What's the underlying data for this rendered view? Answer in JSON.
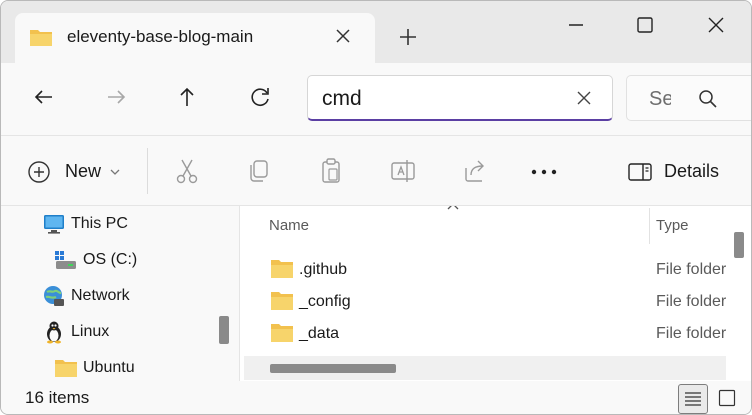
{
  "window": {
    "tab_title": "eleventy-base-blog-main",
    "icons": {
      "tab_icon": "folder-icon",
      "tab_close": "close-icon",
      "new_tab": "plus-icon",
      "minimize": "minimize-icon",
      "maximize": "maximize-icon",
      "close": "close-icon"
    }
  },
  "navigation": {
    "icons": [
      "back-arrow-icon",
      "forward-arrow-icon",
      "up-arrow-icon",
      "refresh-icon"
    ],
    "address_value": "cmd",
    "search_placeholder": "Se"
  },
  "toolbar": {
    "new_label": "New",
    "details_label": "Details",
    "icons": [
      "cut-icon",
      "copy-icon",
      "paste-icon",
      "rename-icon",
      "share-icon",
      "more-icon"
    ]
  },
  "sidebar": {
    "items": [
      {
        "label": "This PC",
        "icon": "this-pc-icon"
      },
      {
        "label": "OS (C:)",
        "icon": "drive-icon"
      },
      {
        "label": "Network",
        "icon": "network-icon"
      },
      {
        "label": "Linux",
        "icon": "linux-penguin-icon"
      },
      {
        "label": "Ubuntu",
        "icon": "folder-icon"
      }
    ]
  },
  "file_list": {
    "columns": [
      "Name",
      "Type"
    ],
    "rows": [
      {
        "name": ".github",
        "type": "File folder"
      },
      {
        "name": "_config",
        "type": "File folder"
      },
      {
        "name": "_data",
        "type": "File folder"
      }
    ]
  },
  "status": {
    "item_count": "16 items",
    "view_icons": [
      "details-view-icon",
      "tiles-view-icon"
    ]
  },
  "colors": {
    "accent": "#5b3fa3",
    "folder": "#f2c14e"
  }
}
